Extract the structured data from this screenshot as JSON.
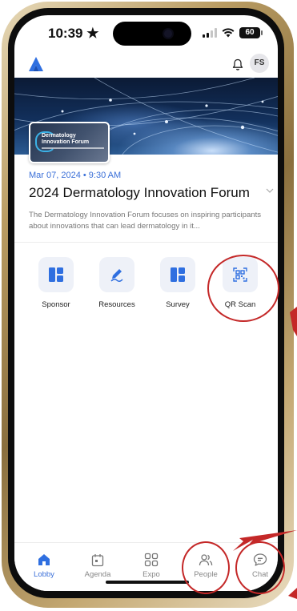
{
  "status_bar": {
    "time": "10:39",
    "battery": "60"
  },
  "header": {
    "avatar_initials": "FS"
  },
  "event": {
    "banner_title_line1": "Dermatology",
    "banner_title_line2": "Innovation Forum",
    "date": "Mar 07, 2024 • 9:30 AM",
    "title": "2024 Dermatology Innovation Forum",
    "description": "The Dermatology Innovation Forum focuses on inspiring participants about innovations that can lead dermatology in it..."
  },
  "actions": [
    {
      "label": "Sponsor",
      "icon": "grid-icon"
    },
    {
      "label": "Resources",
      "icon": "pen-icon"
    },
    {
      "label": "Survey",
      "icon": "grid-icon"
    },
    {
      "label": "QR Scan",
      "icon": "qr-icon"
    }
  ],
  "tabs": [
    {
      "label": "Lobby",
      "icon": "home-icon",
      "active": true
    },
    {
      "label": "Agenda",
      "icon": "calendar-icon",
      "active": false
    },
    {
      "label": "Expo",
      "icon": "apps-icon",
      "active": false
    },
    {
      "label": "People",
      "icon": "people-icon",
      "active": false
    },
    {
      "label": "Chat",
      "icon": "chat-icon",
      "active": false
    }
  ],
  "colors": {
    "accent": "#3a6fd8",
    "annotation": "#c42828"
  }
}
